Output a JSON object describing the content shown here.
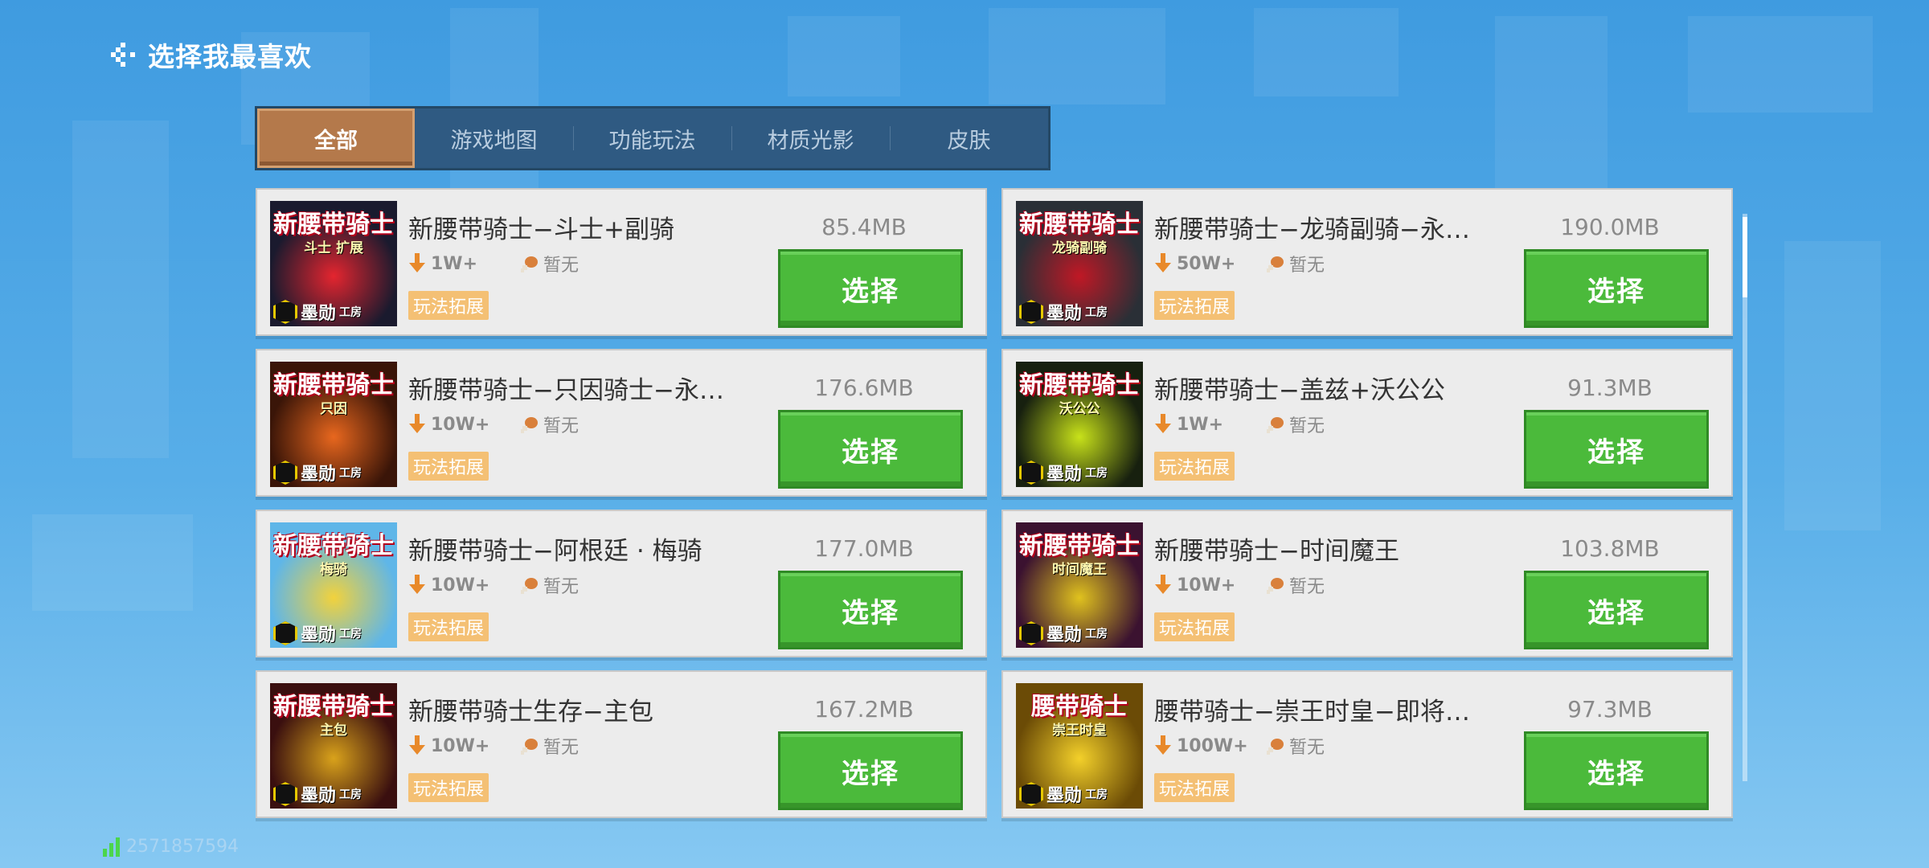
{
  "header": {
    "title": "选择我最喜欢",
    "back_icon": "back-arrow-icon"
  },
  "tabs": [
    {
      "label": "全部",
      "active": true
    },
    {
      "label": "游戏地图",
      "active": false
    },
    {
      "label": "功能玩法",
      "active": false
    },
    {
      "label": "材质光影",
      "active": false
    },
    {
      "label": "皮肤",
      "active": false
    }
  ],
  "cards": [
    {
      "name": "新腰带骑士−斗士+副骑",
      "downloads": "1W+",
      "rating": "暂无",
      "tag": "玩法拓展",
      "size": "85.4MB",
      "button": "选择",
      "thumb": {
        "title": "新腰带骑士",
        "subtitle": "斗士 扩展",
        "logo": "墨勋",
        "logo_sub": "工房",
        "bg": "#1a1a2e",
        "accent": "#e4252f"
      }
    },
    {
      "name": "新腰带骑士−龙骑副骑−永…",
      "downloads": "50W+",
      "rating": "暂无",
      "tag": "玩法拓展",
      "size": "190.0MB",
      "button": "选择",
      "thumb": {
        "title": "新腰带骑士",
        "subtitle": "龙骑副骑",
        "logo": "墨勋",
        "logo_sub": "工房",
        "bg": "#2a2f36",
        "accent": "#c01825"
      }
    },
    {
      "name": "新腰带骑士−只因骑士−永…",
      "downloads": "10W+",
      "rating": "暂无",
      "tag": "玩法拓展",
      "size": "176.6MB",
      "button": "选择",
      "thumb": {
        "title": "新腰带骑士",
        "subtitle": "只因",
        "logo": "墨勋",
        "logo_sub": "工房",
        "bg": "#3a1508",
        "accent": "#e8671e"
      }
    },
    {
      "name": "新腰带骑士−盖兹+沃公公",
      "downloads": "1W+",
      "rating": "暂无",
      "tag": "玩法拓展",
      "size": "91.3MB",
      "button": "选择",
      "thumb": {
        "title": "新腰带骑士",
        "subtitle": "沃公公",
        "logo": "墨勋",
        "logo_sub": "工房",
        "bg": "#17200f",
        "accent": "#c8e21a"
      }
    },
    {
      "name": "新腰带骑士−阿根廷 · 梅骑",
      "downloads": "10W+",
      "rating": "暂无",
      "tag": "玩法拓展",
      "size": "177.0MB",
      "button": "选择",
      "thumb": {
        "title": "新腰带骑士",
        "subtitle": "梅骑",
        "logo": "墨勋",
        "logo_sub": "工房",
        "bg": "#5fb6e8",
        "accent": "#f2d23c"
      }
    },
    {
      "name": "新腰带骑士−时间魔王",
      "downloads": "10W+",
      "rating": "暂无",
      "tag": "玩法拓展",
      "size": "103.8MB",
      "button": "选择",
      "thumb": {
        "title": "新腰带骑士",
        "subtitle": "时间魔王",
        "logo": "墨勋",
        "logo_sub": "工房",
        "bg": "#3b1230",
        "accent": "#e0c21e"
      }
    },
    {
      "name": "新腰带骑士生存−主包",
      "downloads": "10W+",
      "rating": "暂无",
      "tag": "玩法拓展",
      "size": "167.2MB",
      "button": "选择",
      "thumb": {
        "title": "新腰带骑士",
        "subtitle": "主包",
        "logo": "墨勋",
        "logo_sub": "工房",
        "bg": "#3a0f0f",
        "accent": "#d9a21b"
      }
    },
    {
      "name": "腰带骑士−崇王时皇−即将…",
      "downloads": "100W+",
      "rating": "暂无",
      "tag": "玩法拓展",
      "size": "97.3MB",
      "button": "选择",
      "thumb": {
        "title": "腰带骑士",
        "subtitle": "崇王时皇",
        "logo": "墨勋",
        "logo_sub": "工房",
        "bg": "#6b4b06",
        "accent": "#f3d02a"
      }
    }
  ],
  "footer": {
    "uid": "2571857594",
    "signal_icon": "signal-bars-icon"
  },
  "colors": {
    "select_button": "#4bba3b",
    "tag_bg": "#f4c074",
    "tab_active": "#b4794b",
    "tabbar_bg": "#2f5a82"
  }
}
